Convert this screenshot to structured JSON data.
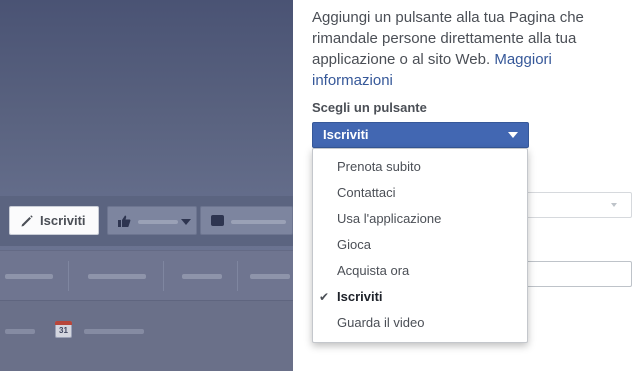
{
  "preview": {
    "cta_label": "Iscriviti",
    "calendar_day": "31"
  },
  "panel": {
    "intro_text": "Aggiungi un pulsante alla tua Pagina che rimandale persone direttamente alla tua applicazione o al sito Web.",
    "more_link": "Maggiori informazioni",
    "choose_label": "Scegli un pulsante",
    "selected_value": "Iscriviti"
  },
  "menu": {
    "items": [
      {
        "label": "Prenota subito",
        "selected": false
      },
      {
        "label": "Contattaci",
        "selected": false
      },
      {
        "label": "Usa l'applicazione",
        "selected": false
      },
      {
        "label": "Gioca",
        "selected": false
      },
      {
        "label": "Acquista ora",
        "selected": false
      },
      {
        "label": "Iscriviti",
        "selected": true
      },
      {
        "label": "Guarda il video",
        "selected": false
      }
    ],
    "check_glyph": "✔"
  },
  "colors": {
    "accent": "#4267b2",
    "link": "#365899",
    "text": "#4b4f56",
    "overlay": "#5b6480"
  }
}
